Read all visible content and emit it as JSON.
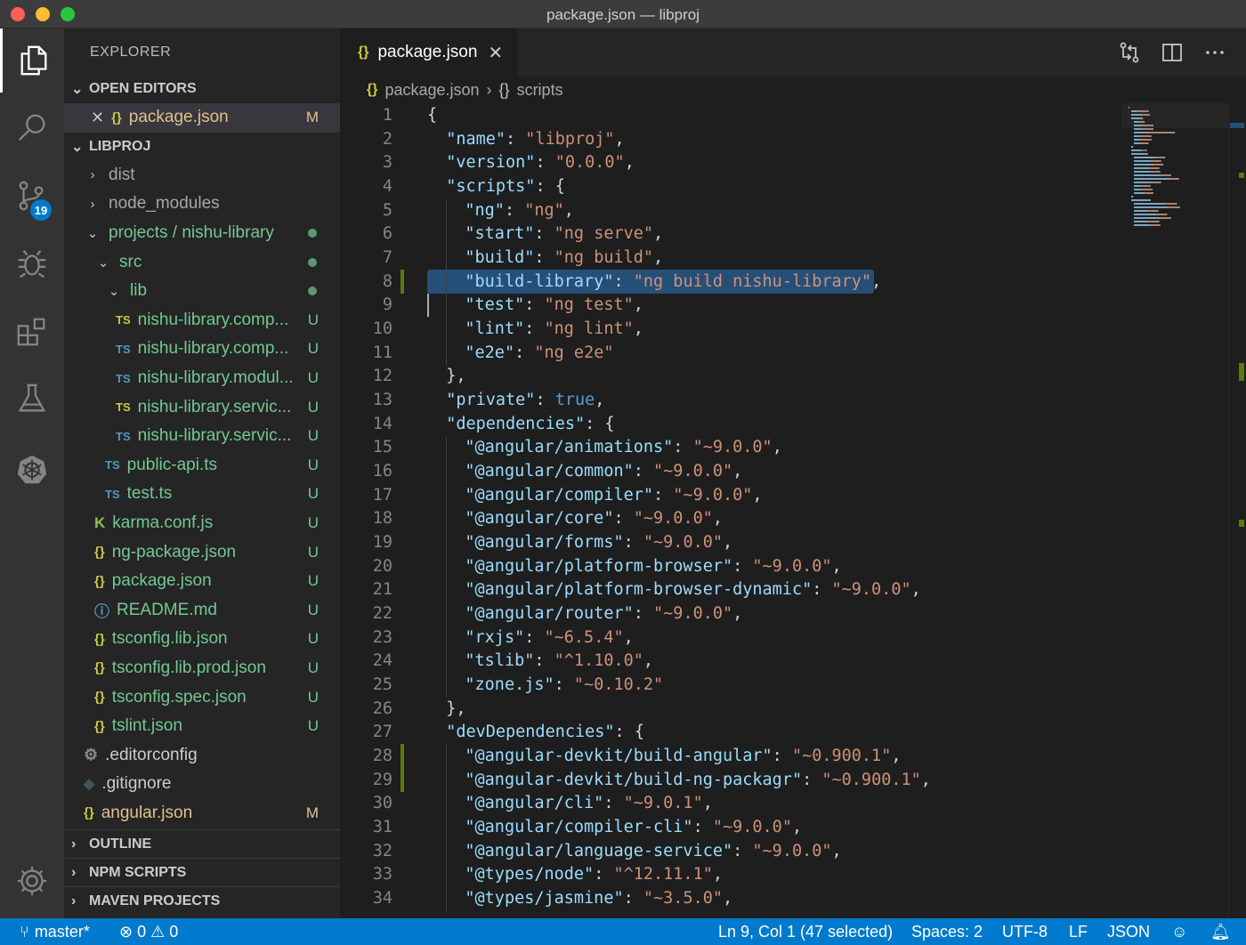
{
  "window": {
    "title": "package.json — libproj"
  },
  "activity_bar": {
    "items": [
      "explorer-icon",
      "search-icon",
      "source-control-icon",
      "debug-icon",
      "extensions-icon",
      "testing-icon",
      "kubernetes-icon"
    ],
    "source_control_badge": "19",
    "settings": "gear-icon"
  },
  "sidebar": {
    "title": "EXPLORER",
    "open_editors": {
      "header": "OPEN EDITORS",
      "items": [
        {
          "name": "package.json",
          "status": "M"
        }
      ]
    },
    "project": {
      "header": "LIBPROJ",
      "items": [
        {
          "name": "dist",
          "status": ""
        },
        {
          "name": "node_modules",
          "status": ""
        },
        {
          "name": "projects / nishu-library",
          "status": ""
        },
        {
          "name": "src",
          "status": ""
        },
        {
          "name": "lib",
          "status": ""
        },
        {
          "name": "nishu-library.comp...",
          "status": "U",
          "icon": "TS"
        },
        {
          "name": "nishu-library.comp...",
          "status": "U",
          "icon": "TS"
        },
        {
          "name": "nishu-library.modul...",
          "status": "U",
          "icon": "TS"
        },
        {
          "name": "nishu-library.servic...",
          "status": "U",
          "icon": "TS"
        },
        {
          "name": "nishu-library.servic...",
          "status": "U",
          "icon": "TS"
        },
        {
          "name": "public-api.ts",
          "status": "U",
          "icon": "TS"
        },
        {
          "name": "test.ts",
          "status": "U",
          "icon": "TS"
        },
        {
          "name": "karma.conf.js",
          "status": "U"
        },
        {
          "name": "ng-package.json",
          "status": "U",
          "icon": "{}"
        },
        {
          "name": "package.json",
          "status": "U",
          "icon": "{}"
        },
        {
          "name": "README.md",
          "status": "U"
        },
        {
          "name": "tsconfig.lib.json",
          "status": "U",
          "icon": "{}"
        },
        {
          "name": "tsconfig.lib.prod.json",
          "status": "U",
          "icon": "{}"
        },
        {
          "name": "tsconfig.spec.json",
          "status": "U",
          "icon": "{}"
        },
        {
          "name": "tslint.json",
          "status": "U",
          "icon": "{}"
        },
        {
          "name": ".editorconfig",
          "status": ""
        },
        {
          "name": ".gitignore",
          "status": ""
        },
        {
          "name": "angular.json",
          "status": "M",
          "icon": "{}"
        }
      ]
    },
    "sections": [
      "OUTLINE",
      "NPM SCRIPTS",
      "MAVEN PROJECTS"
    ]
  },
  "tabs": [
    {
      "label": "package.json",
      "icon": "{}"
    }
  ],
  "breadcrumb": {
    "file": "package.json",
    "symbol": "scripts"
  },
  "editor": {
    "lines": [
      [
        [
          "p",
          "{"
        ]
      ],
      [
        [
          "k",
          "\"name\""
        ],
        [
          "p",
          ": "
        ],
        [
          "s",
          "\"libproj\""
        ],
        [
          "p",
          ","
        ]
      ],
      [
        [
          "k",
          "\"version\""
        ],
        [
          "p",
          ": "
        ],
        [
          "s",
          "\"0.0.0\""
        ],
        [
          "p",
          ","
        ]
      ],
      [
        [
          "k",
          "\"scripts\""
        ],
        [
          "p",
          ": {"
        ]
      ],
      [
        [
          "k",
          "\"ng\""
        ],
        [
          "p",
          ": "
        ],
        [
          "s",
          "\"ng\""
        ],
        [
          "p",
          ","
        ]
      ],
      [
        [
          "k",
          "\"start\""
        ],
        [
          "p",
          ": "
        ],
        [
          "s",
          "\"ng serve\""
        ],
        [
          "p",
          ","
        ]
      ],
      [
        [
          "k",
          "\"build\""
        ],
        [
          "p",
          ": "
        ],
        [
          "s",
          "\"ng build\""
        ],
        [
          "p",
          ","
        ]
      ],
      [
        [
          "k",
          "\"build-library\""
        ],
        [
          "p",
          ": "
        ],
        [
          "s",
          "\"ng build nishu-library\""
        ],
        [
          "p",
          ","
        ]
      ],
      [
        [
          "k",
          "\"test\""
        ],
        [
          "p",
          ": "
        ],
        [
          "s",
          "\"ng test\""
        ],
        [
          "p",
          ","
        ]
      ],
      [
        [
          "k",
          "\"lint\""
        ],
        [
          "p",
          ": "
        ],
        [
          "s",
          "\"ng lint\""
        ],
        [
          "p",
          ","
        ]
      ],
      [
        [
          "k",
          "\"e2e\""
        ],
        [
          "p",
          ": "
        ],
        [
          "s",
          "\"ng e2e\""
        ]
      ],
      [
        [
          "p",
          "},"
        ]
      ],
      [
        [
          "k",
          "\"private\""
        ],
        [
          "p",
          ": "
        ],
        [
          "b",
          "true"
        ],
        [
          "p",
          ","
        ]
      ],
      [
        [
          "k",
          "\"dependencies\""
        ],
        [
          "p",
          ": {"
        ]
      ],
      [
        [
          "k",
          "\"@angular/animations\""
        ],
        [
          "p",
          ": "
        ],
        [
          "s",
          "\"~9.0.0\""
        ],
        [
          "p",
          ","
        ]
      ],
      [
        [
          "k",
          "\"@angular/common\""
        ],
        [
          "p",
          ": "
        ],
        [
          "s",
          "\"~9.0.0\""
        ],
        [
          "p",
          ","
        ]
      ],
      [
        [
          "k",
          "\"@angular/compiler\""
        ],
        [
          "p",
          ": "
        ],
        [
          "s",
          "\"~9.0.0\""
        ],
        [
          "p",
          ","
        ]
      ],
      [
        [
          "k",
          "\"@angular/core\""
        ],
        [
          "p",
          ": "
        ],
        [
          "s",
          "\"~9.0.0\""
        ],
        [
          "p",
          ","
        ]
      ],
      [
        [
          "k",
          "\"@angular/forms\""
        ],
        [
          "p",
          ": "
        ],
        [
          "s",
          "\"~9.0.0\""
        ],
        [
          "p",
          ","
        ]
      ],
      [
        [
          "k",
          "\"@angular/platform-browser\""
        ],
        [
          "p",
          ": "
        ],
        [
          "s",
          "\"~9.0.0\""
        ],
        [
          "p",
          ","
        ]
      ],
      [
        [
          "k",
          "\"@angular/platform-browser-dynamic\""
        ],
        [
          "p",
          ": "
        ],
        [
          "s",
          "\"~9.0.0\""
        ],
        [
          "p",
          ","
        ]
      ],
      [
        [
          "k",
          "\"@angular/router\""
        ],
        [
          "p",
          ": "
        ],
        [
          "s",
          "\"~9.0.0\""
        ],
        [
          "p",
          ","
        ]
      ],
      [
        [
          "k",
          "\"rxjs\""
        ],
        [
          "p",
          ": "
        ],
        [
          "s",
          "\"~6.5.4\""
        ],
        [
          "p",
          ","
        ]
      ],
      [
        [
          "k",
          "\"tslib\""
        ],
        [
          "p",
          ": "
        ],
        [
          "s",
          "\"^1.10.0\""
        ],
        [
          "p",
          ","
        ]
      ],
      [
        [
          "k",
          "\"zone.js\""
        ],
        [
          "p",
          ": "
        ],
        [
          "s",
          "\"~0.10.2\""
        ]
      ],
      [
        [
          "p",
          "},"
        ]
      ],
      [
        [
          "k",
          "\"devDependencies\""
        ],
        [
          "p",
          ": {"
        ]
      ],
      [
        [
          "k",
          "\"@angular-devkit/build-angular\""
        ],
        [
          "p",
          ": "
        ],
        [
          "s",
          "\"~0.900.1\""
        ],
        [
          "p",
          ","
        ]
      ],
      [
        [
          "k",
          "\"@angular-devkit/build-ng-packagr\""
        ],
        [
          "p",
          ": "
        ],
        [
          "s",
          "\"~0.900.1\""
        ],
        [
          "p",
          ","
        ]
      ],
      [
        [
          "k",
          "\"@angular/cli\""
        ],
        [
          "p",
          ": "
        ],
        [
          "s",
          "\"~9.0.1\""
        ],
        [
          "p",
          ","
        ]
      ],
      [
        [
          "k",
          "\"@angular/compiler-cli\""
        ],
        [
          "p",
          ": "
        ],
        [
          "s",
          "\"~9.0.0\""
        ],
        [
          "p",
          ","
        ]
      ],
      [
        [
          "k",
          "\"@angular/language-service\""
        ],
        [
          "p",
          ": "
        ],
        [
          "s",
          "\"~9.0.0\""
        ],
        [
          "p",
          ","
        ]
      ],
      [
        [
          "k",
          "\"@types/node\""
        ],
        [
          "p",
          ": "
        ],
        [
          "s",
          "\"^12.11.1\""
        ],
        [
          "p",
          ","
        ]
      ],
      [
        [
          "k",
          "\"@types/jasmine\""
        ],
        [
          "p",
          ": "
        ],
        [
          "s",
          "\"~3.5.0\""
        ],
        [
          "p",
          ","
        ]
      ]
    ],
    "indent": [
      0,
      1,
      1,
      1,
      2,
      2,
      2,
      2,
      2,
      2,
      2,
      1,
      1,
      1,
      2,
      2,
      2,
      2,
      2,
      2,
      2,
      2,
      2,
      2,
      2,
      1,
      1,
      2,
      2,
      2,
      2,
      2,
      2,
      2
    ]
  },
  "status_bar": {
    "branch": "master*",
    "errors": "0",
    "warnings": "0",
    "cursor": "Ln 9, Col 1 (47 selected)",
    "spaces": "Spaces: 2",
    "encoding": "UTF-8",
    "eol": "LF",
    "language": "JSON"
  },
  "colors": {
    "accent": "#007acc",
    "untracked": "#73c991",
    "modified": "#e2c08d",
    "selection": "#264f78"
  }
}
